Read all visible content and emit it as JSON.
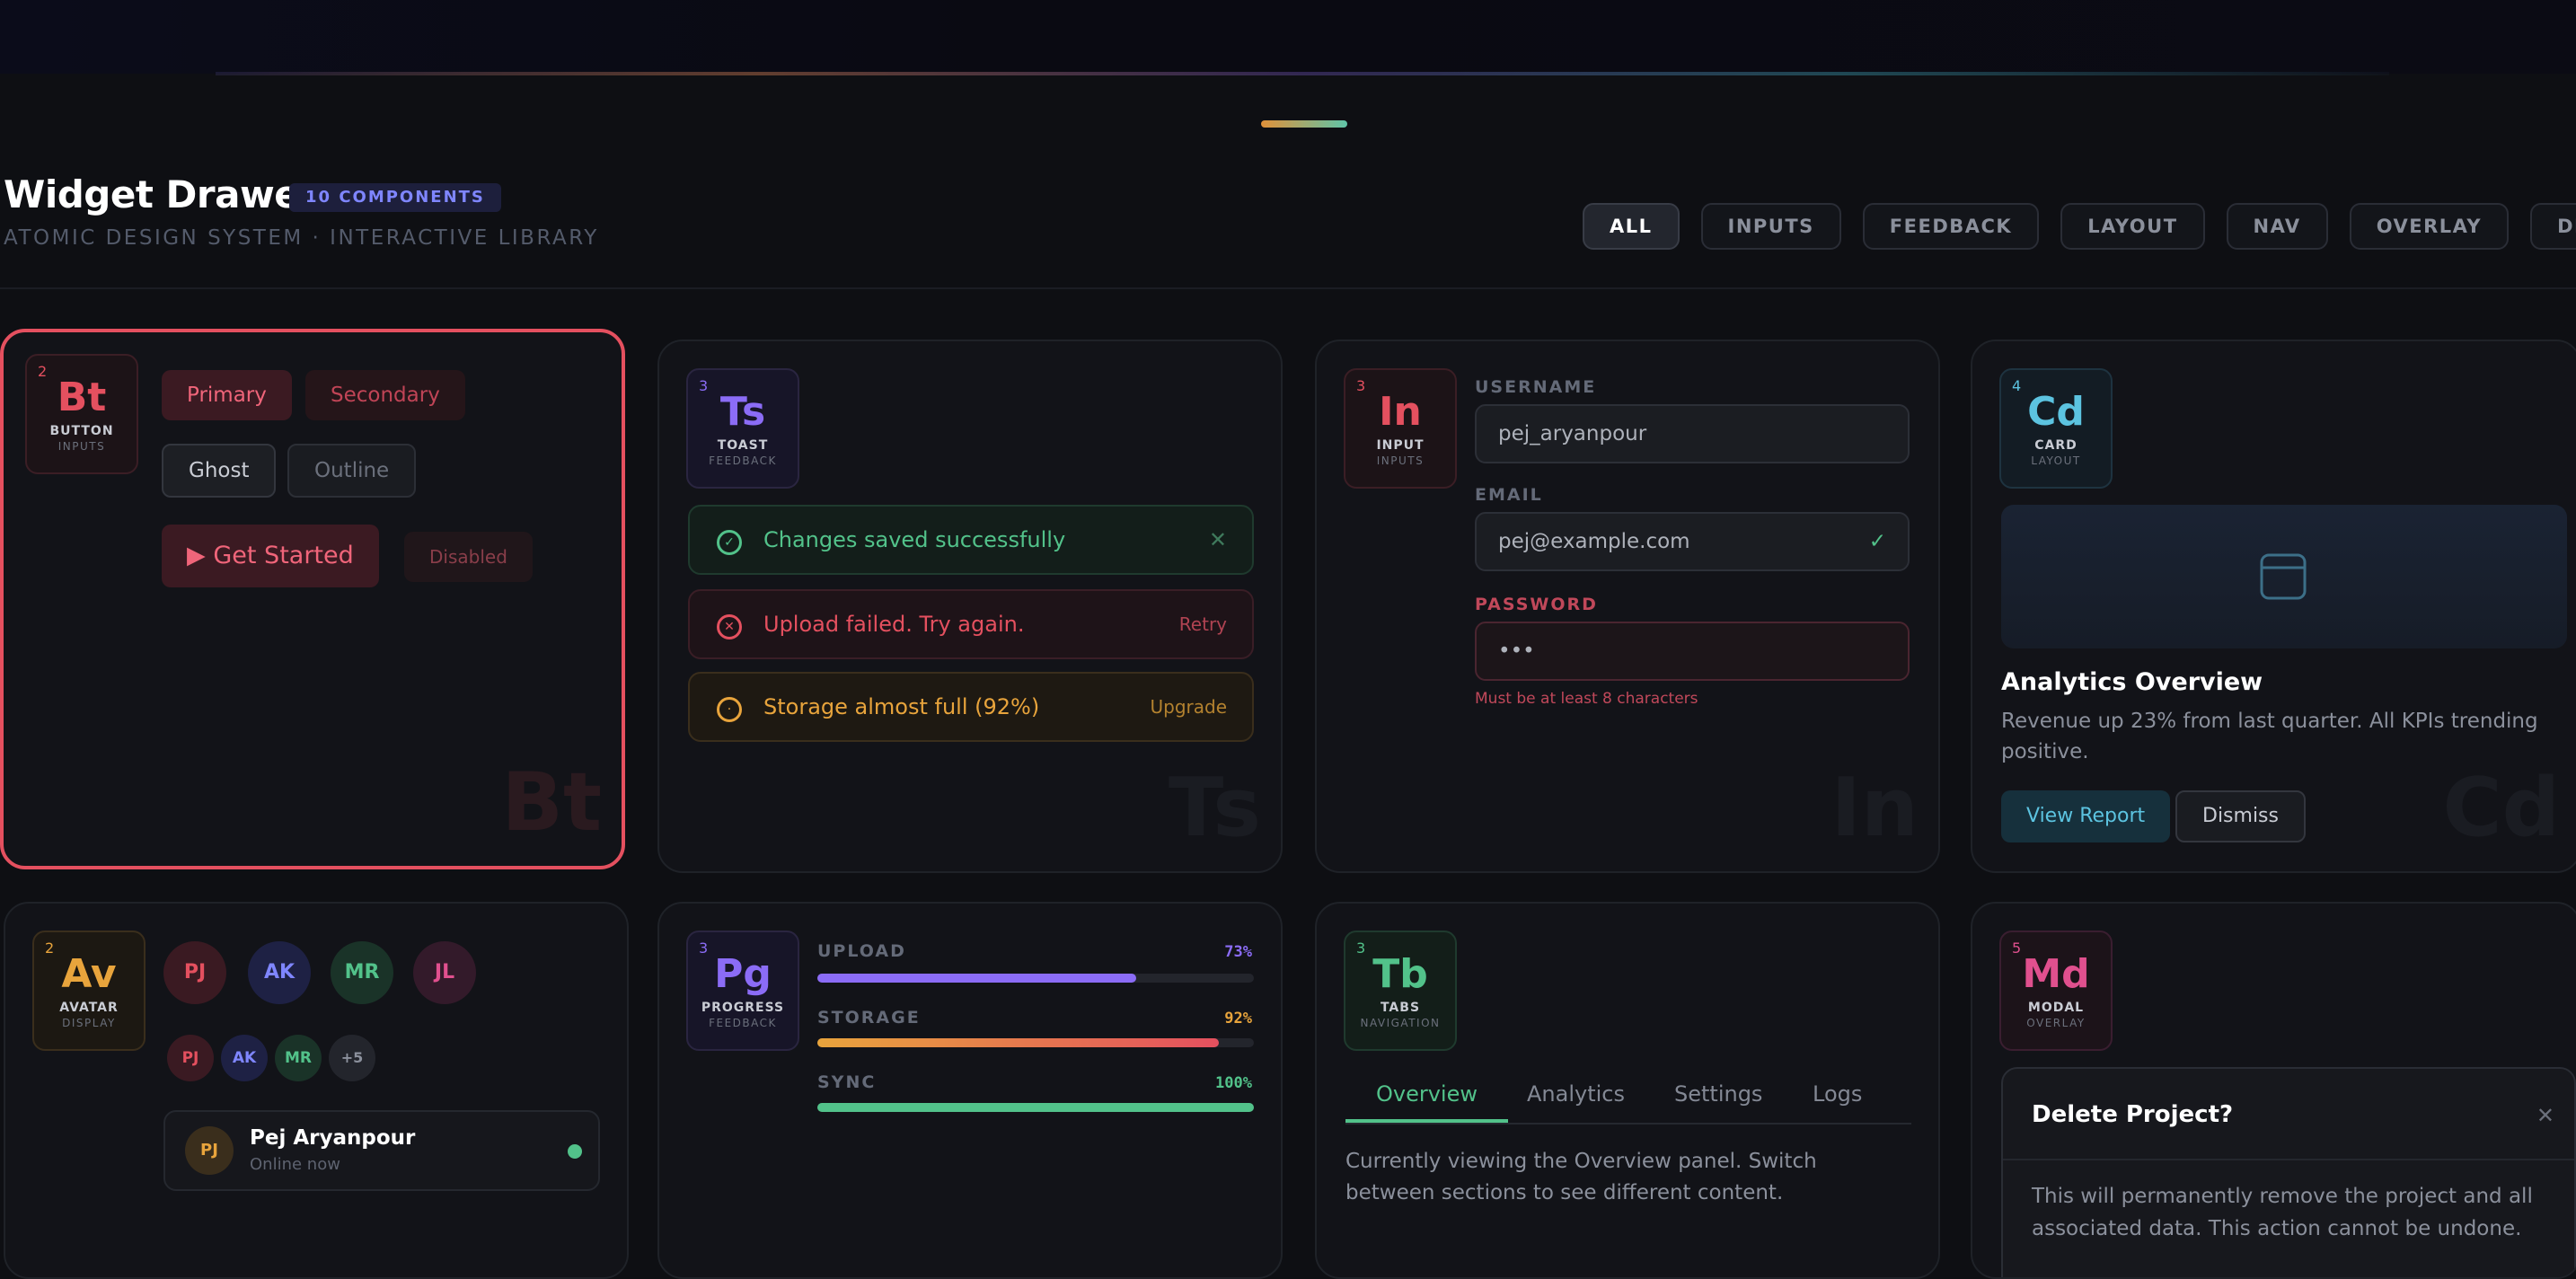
{
  "header": {
    "title": "Widget Drawer",
    "count_badge": "10 COMPONENTS",
    "subtitle": "ATOMIC DESIGN SYSTEM · INTERACTIVE LIBRARY"
  },
  "filters": [
    "ALL",
    "INPUTS",
    "FEEDBACK",
    "LAYOUT",
    "NAV",
    "OVERLAY",
    "DISPLAY"
  ],
  "active_filter": "ALL",
  "colors": {
    "button": "#e4505f",
    "toast": "#8b6cf6",
    "input": "#e4505f",
    "card": "#5cc3e0",
    "avatar": "#e8a43c",
    "progress": "#8b6cf6",
    "tabs": "#52c28a",
    "modal": "#e0508e",
    "success": "#52c28a",
    "error": "#e4505f",
    "warning": "#e8a43c"
  },
  "cards": {
    "button": {
      "tile": {
        "num": "2",
        "sym": "Bt",
        "name": "BUTTON",
        "cat": "INPUTS"
      },
      "primary": "Primary",
      "secondary": "Secondary",
      "ghost": "Ghost",
      "outline": "Outline",
      "cta": "Get Started",
      "disabled": "Disabled"
    },
    "toast": {
      "tile": {
        "num": "3",
        "sym": "Ts",
        "name": "TOAST",
        "cat": "FEEDBACK"
      },
      "success": "Changes saved successfully",
      "error": "Upload failed. Try again.",
      "error_action": "Retry",
      "warning": "Storage almost full (92%)",
      "warning_action": "Upgrade"
    },
    "input": {
      "tile": {
        "num": "3",
        "sym": "In",
        "name": "INPUT",
        "cat": "INPUTS"
      },
      "username_label": "USERNAME",
      "username_value": "pej_aryanpour",
      "email_label": "EMAIL",
      "email_value": "pej@example.com",
      "password_label": "PASSWORD",
      "password_value": "•••",
      "password_error": "Must be at least 8 characters"
    },
    "card": {
      "tile": {
        "num": "4",
        "sym": "Cd",
        "name": "CARD",
        "cat": "LAYOUT"
      },
      "heading": "Analytics Overview",
      "body": "Revenue up 23% from last quarter. All KPIs trending positive.",
      "primary": "View Report",
      "secondary": "Dismiss"
    },
    "avatar": {
      "tile": {
        "num": "2",
        "sym": "Av",
        "name": "AVATAR",
        "cat": "DISPLAY"
      },
      "large": [
        "PJ",
        "AK",
        "MR",
        "JL"
      ],
      "small": [
        "PJ",
        "AK",
        "MR",
        "+5"
      ],
      "user_name": "Pej Aryanpour",
      "user_status": "Online now",
      "user_initials": "PJ"
    },
    "progress": {
      "tile": {
        "num": "3",
        "sym": "Pg",
        "name": "PROGRESS",
        "cat": "FEEDBACK"
      },
      "bars": [
        {
          "label": "UPLOAD",
          "value": 73,
          "text": "73%"
        },
        {
          "label": "STORAGE",
          "value": 92,
          "text": "92%"
        },
        {
          "label": "SYNC",
          "value": 100,
          "text": "100%"
        }
      ]
    },
    "tabs": {
      "tile": {
        "num": "3",
        "sym": "Tb",
        "name": "TABS",
        "cat": "NAVIGATION"
      },
      "items": [
        "Overview",
        "Analytics",
        "Settings",
        "Logs"
      ],
      "active": "Overview",
      "body": "Currently viewing the Overview panel. Switch between sections to see different content."
    },
    "modal": {
      "tile": {
        "num": "5",
        "sym": "Md",
        "name": "MODAL",
        "cat": "OVERLAY"
      },
      "title": "Delete Project?",
      "body": "This will permanently remove the project and all associated data. This action cannot be undone."
    }
  }
}
